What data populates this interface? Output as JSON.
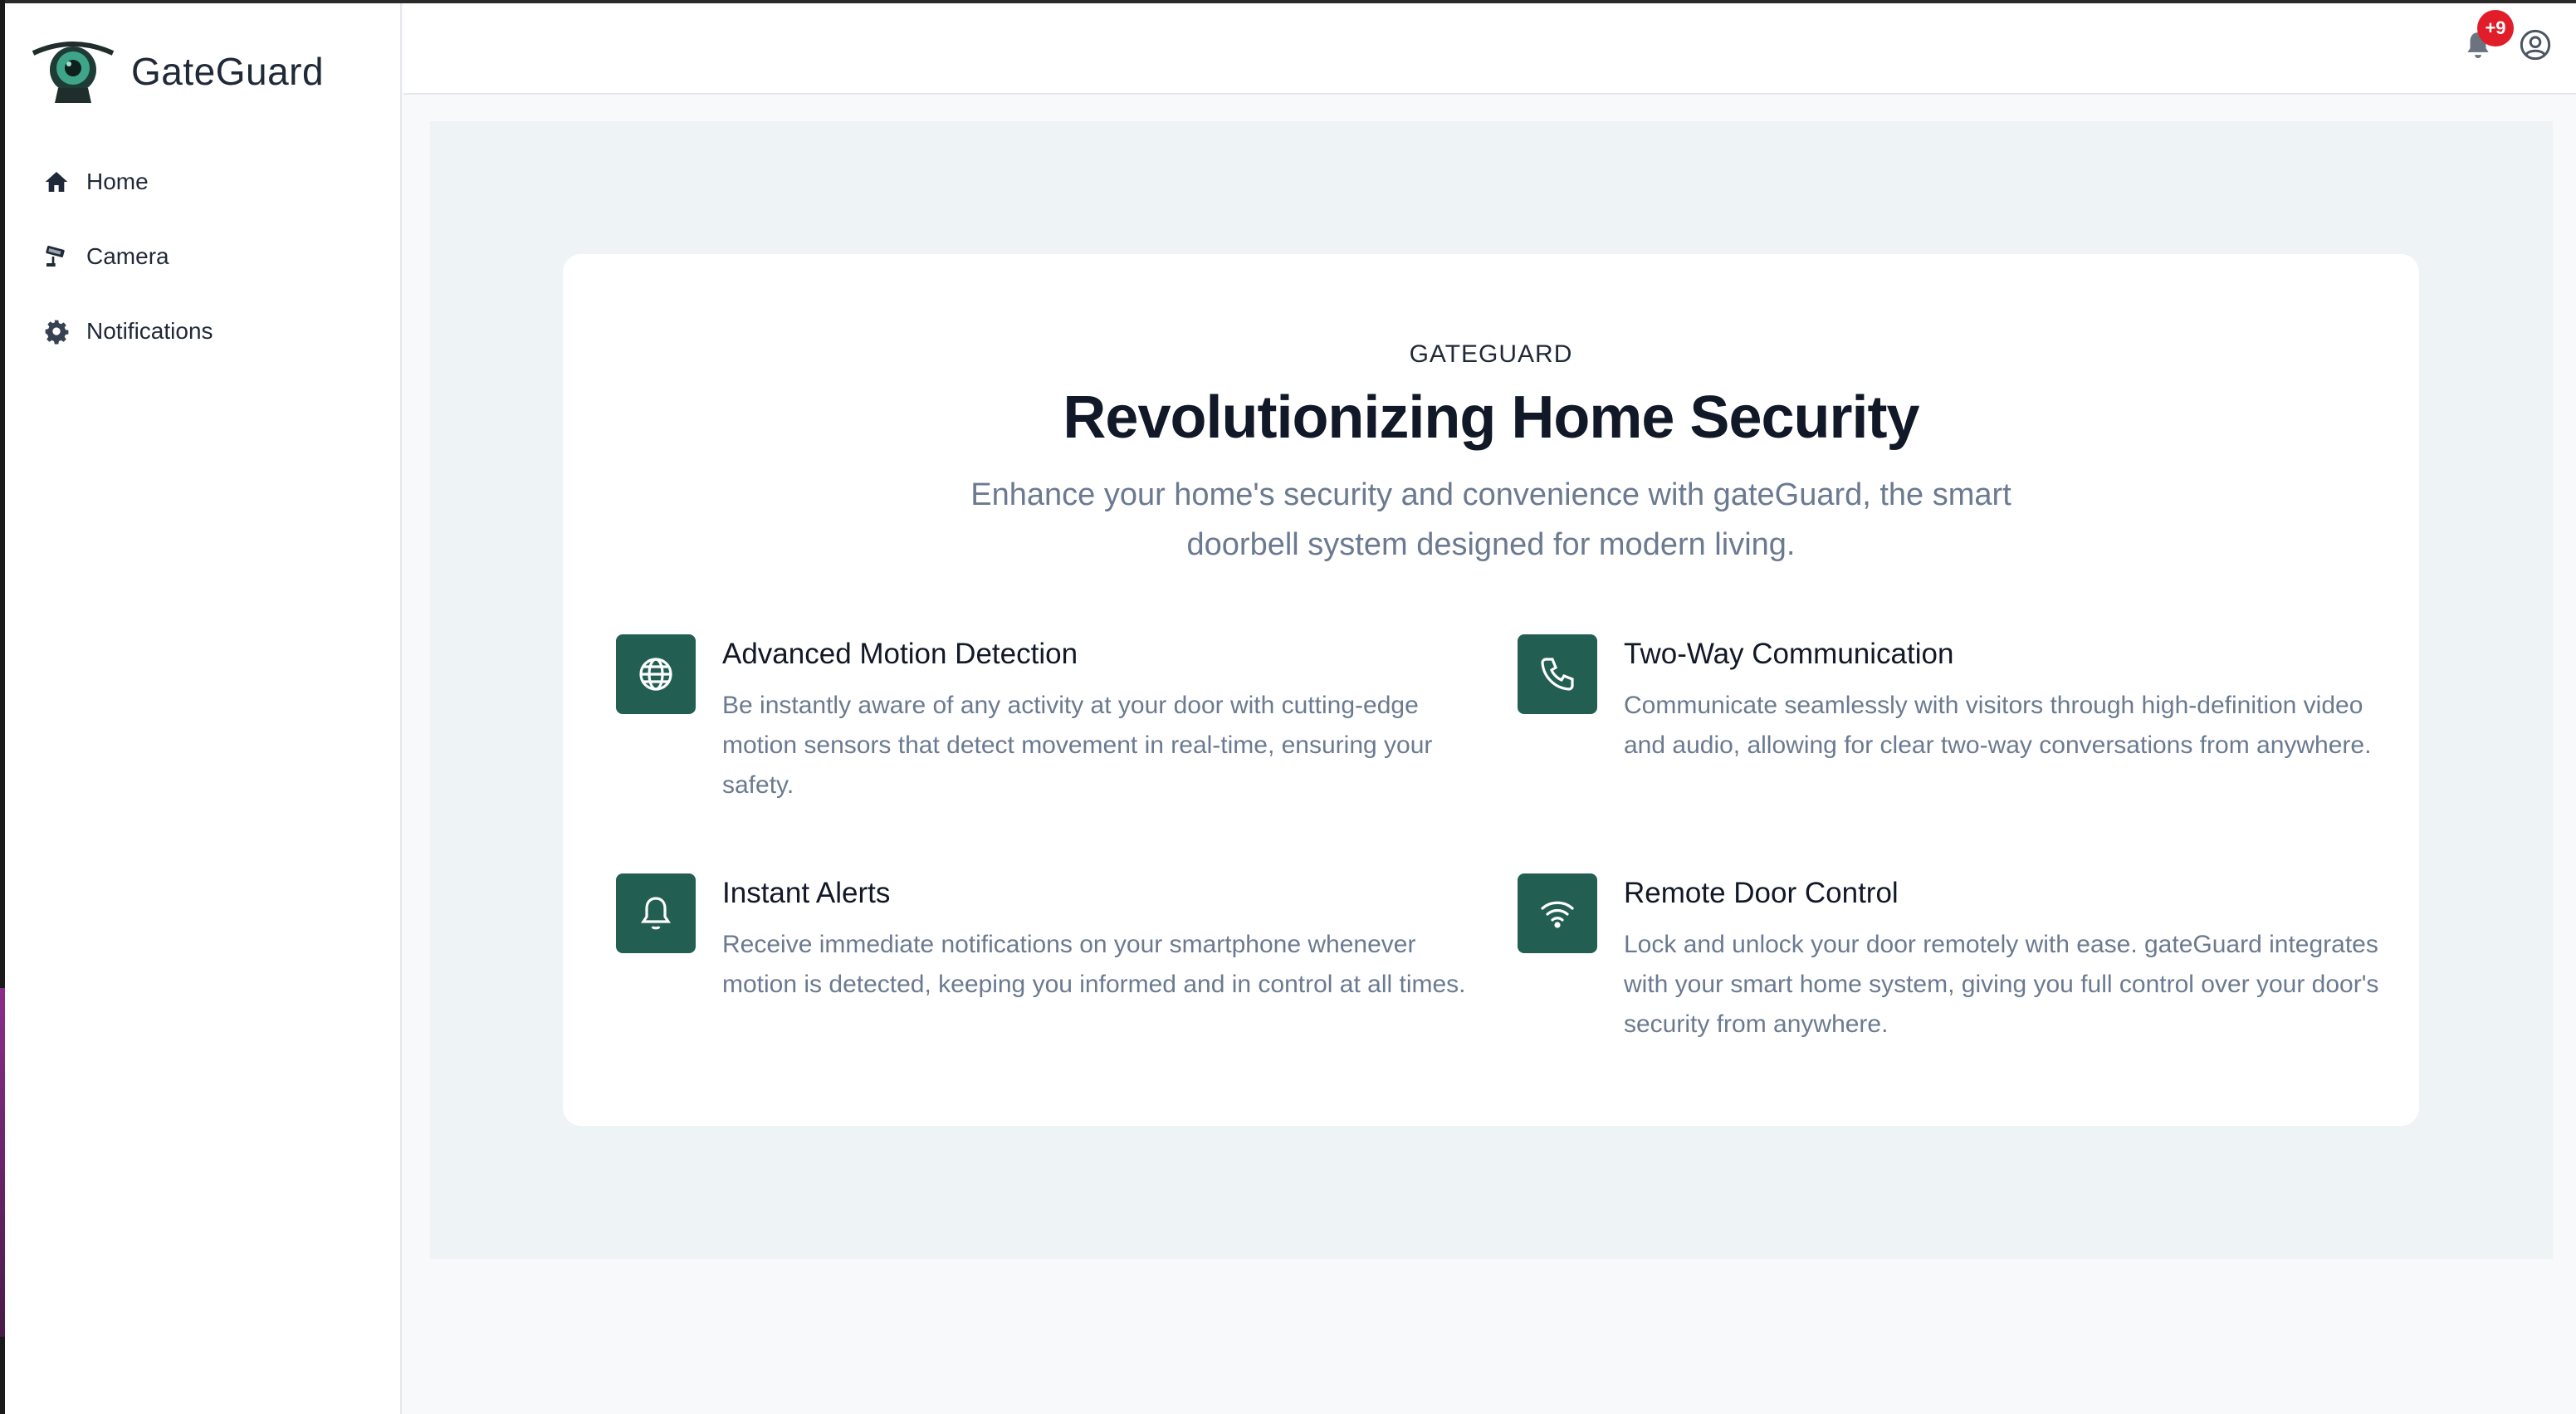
{
  "app": {
    "name": "GateGuard",
    "logo_icon": "camera-eye-logo"
  },
  "sidebar": {
    "items": [
      {
        "label": "Home",
        "icon": "home-icon"
      },
      {
        "label": "Camera",
        "icon": "camera-icon"
      },
      {
        "label": "Notifications",
        "icon": "gear-icon"
      }
    ]
  },
  "header": {
    "notification_count": "+9",
    "bell_icon": "bell-icon",
    "user_icon": "user-circle-icon"
  },
  "hero": {
    "eyebrow": "GATEGUARD",
    "title": "Revolutionizing Home Security",
    "subtitle": "Enhance your home's security and convenience with gateGuard, the smart doorbell system designed for modern living."
  },
  "features": [
    {
      "title": "Advanced Motion Detection",
      "description": "Be instantly aware of any activity at your door with cutting-edge motion sensors that detect movement in real-time, ensuring your safety.",
      "icon": "globe-icon"
    },
    {
      "title": "Two-Way Communication",
      "description": "Communicate seamlessly with visitors through high-definition video and audio, allowing for clear two-way conversations from anywhere.",
      "icon": "phone-icon"
    },
    {
      "title": "Instant Alerts",
      "description": "Receive immediate notifications on your smartphone whenever motion is detected, keeping you informed and in control at all times.",
      "icon": "bell-icon"
    },
    {
      "title": "Remote Door Control",
      "description": "Lock and unlock your door remotely with ease. gateGuard integrates with your smart home system, giving you full control over your door's security from anywhere.",
      "icon": "wifi-icon"
    }
  ],
  "colors": {
    "accent": "#225f52",
    "badge": "#e11d2a",
    "muted_text": "#6b7a90",
    "page_bg": "#eef3f6"
  }
}
